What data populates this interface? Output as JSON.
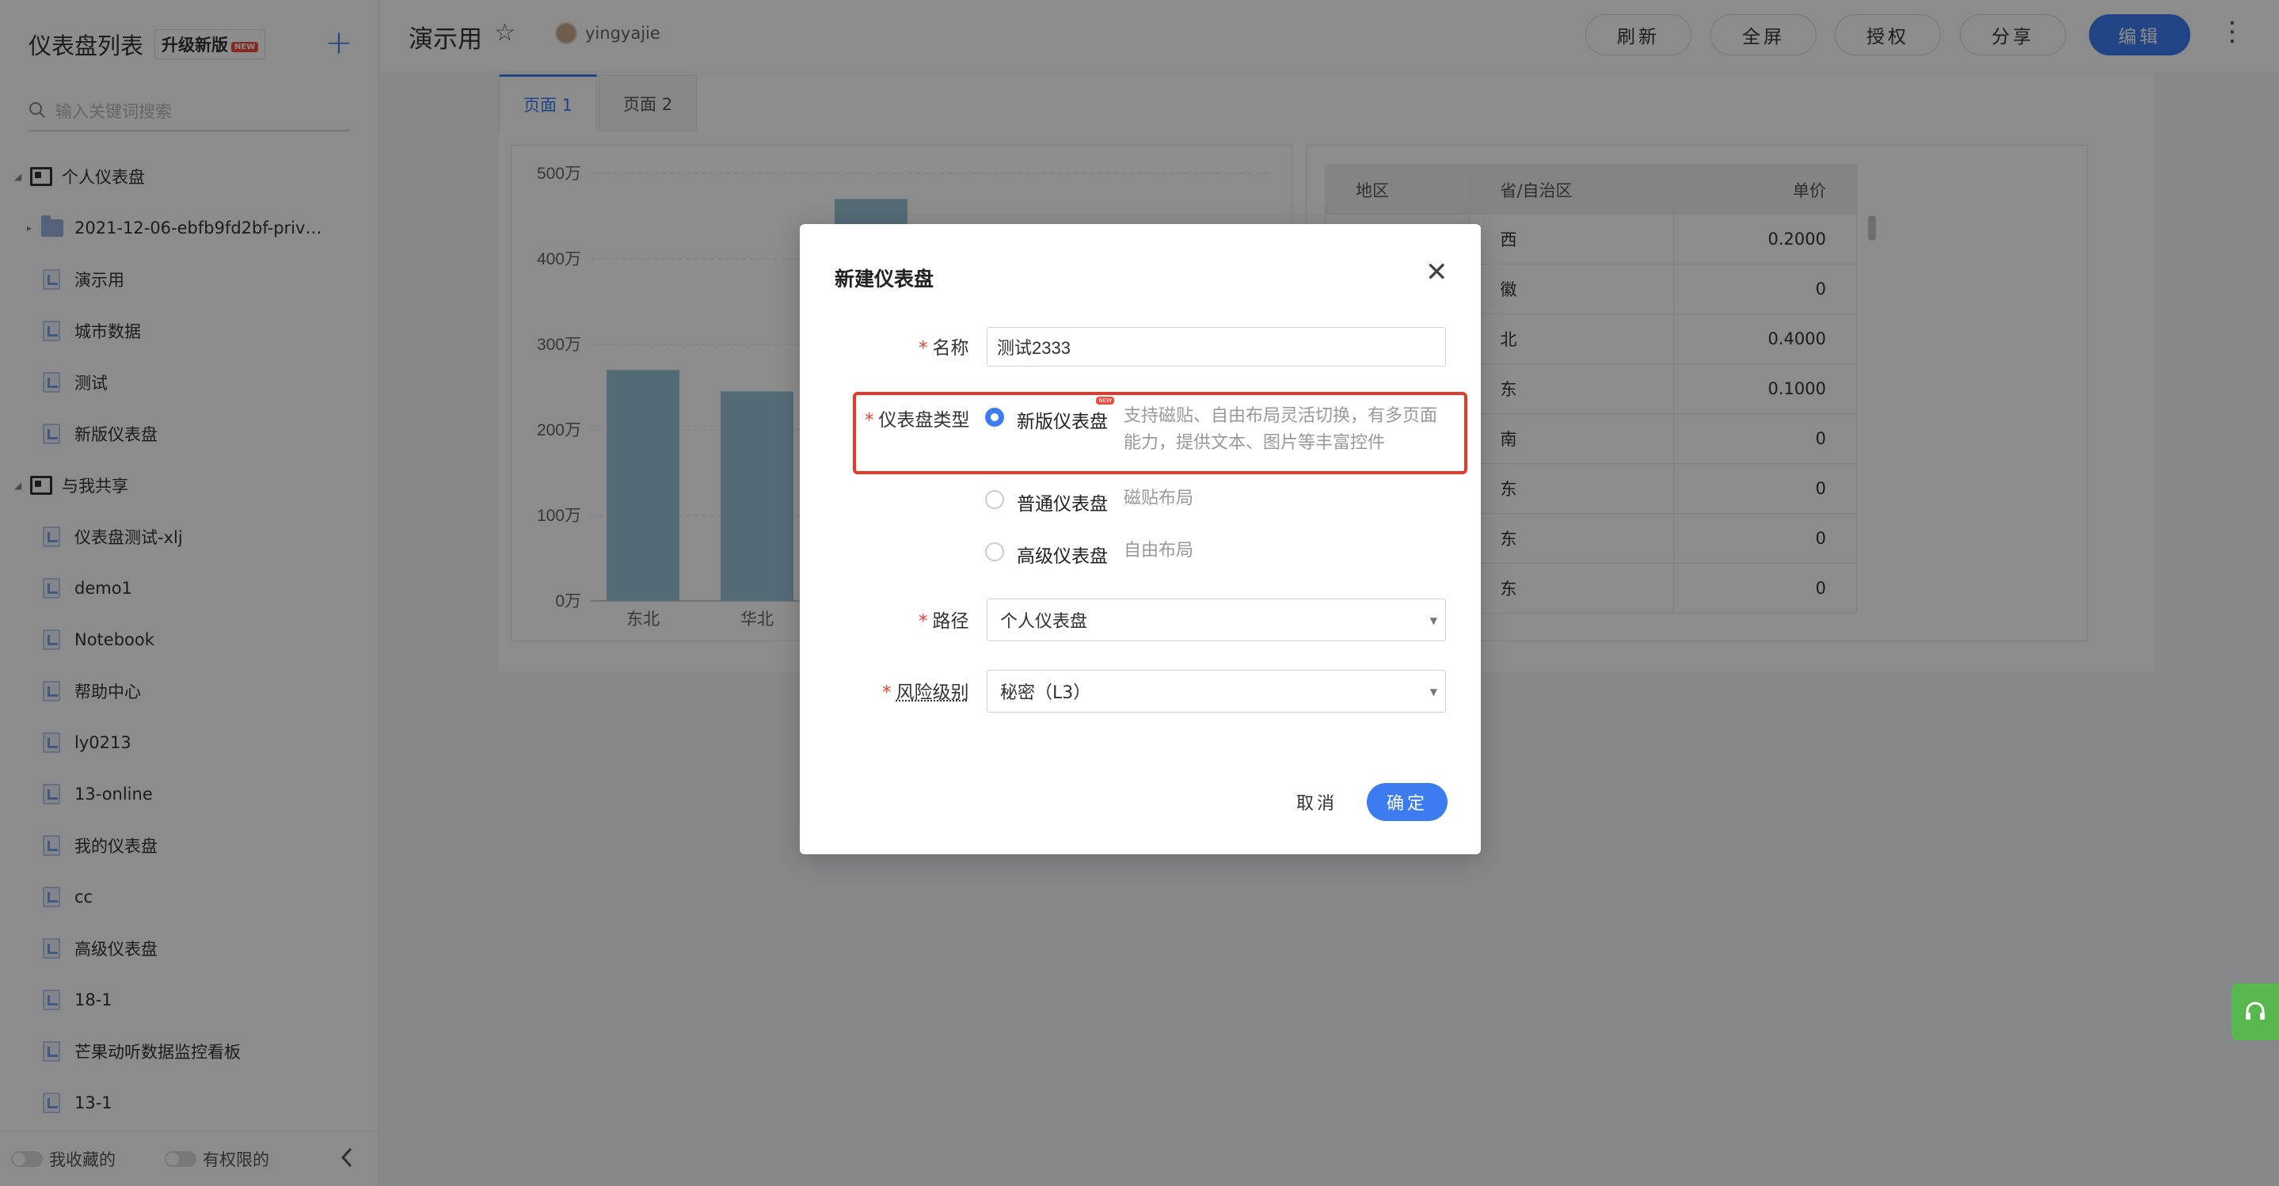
{
  "sidebar": {
    "title": "仪表盘列表",
    "upgrade_label": "升级新版",
    "upgrade_badge": "NEW",
    "add_icon": "+",
    "search_placeholder": "输入关键词搜索",
    "groups": [
      {
        "label": "个人仪表盘",
        "items": [
          {
            "label": "2021-12-06-ebfb9fd2bf-privat...",
            "type": "folder"
          },
          {
            "label": "演示用",
            "type": "doc"
          },
          {
            "label": "城市数据",
            "type": "doc"
          },
          {
            "label": "测试",
            "type": "doc"
          },
          {
            "label": "新版仪表盘",
            "type": "doc"
          }
        ]
      },
      {
        "label": "与我共享",
        "items": [
          {
            "label": "仪表盘测试-xlj",
            "type": "doc"
          },
          {
            "label": "demo1",
            "type": "doc"
          },
          {
            "label": "Notebook",
            "type": "doc"
          },
          {
            "label": "帮助中心",
            "type": "doc"
          },
          {
            "label": "ly0213",
            "type": "doc"
          },
          {
            "label": "13-online",
            "type": "doc"
          },
          {
            "label": "我的仪表盘",
            "type": "doc"
          },
          {
            "label": "cc",
            "type": "doc"
          },
          {
            "label": "高级仪表盘",
            "type": "doc"
          },
          {
            "label": "18-1",
            "type": "doc"
          },
          {
            "label": "芒果动听数据监控看板",
            "type": "doc"
          },
          {
            "label": "13-1",
            "type": "doc"
          }
        ]
      }
    ],
    "footer": {
      "favorites_label": "我收藏的",
      "permitted_label": "有权限的"
    }
  },
  "header": {
    "title": "演示用",
    "owner": "yingyajie",
    "buttons": {
      "refresh": "刷新",
      "fullscreen": "全屏",
      "authorize": "授权",
      "share": "分享",
      "edit": "编辑"
    }
  },
  "tabs": [
    "页面 1",
    "页面 2"
  ],
  "chart_data": {
    "type": "bar",
    "categories": [
      "东北",
      "华北",
      ""
    ],
    "values": [
      2700000,
      2450000,
      4700000
    ],
    "yticks": [
      "0万",
      "100万",
      "200万",
      "300万",
      "400万",
      "500万"
    ],
    "ylim": [
      0,
      5000000
    ],
    "bar_color": "#96c4d6"
  },
  "table": {
    "headers": [
      "地区",
      "省/自治区",
      "单价"
    ],
    "rows": [
      [
        "",
        "西",
        "0.2000"
      ],
      [
        "",
        "徽",
        "0"
      ],
      [
        "",
        "北",
        "0.4000"
      ],
      [
        "",
        "东",
        "0.1000"
      ],
      [
        "",
        "南",
        "0"
      ],
      [
        "",
        "东",
        "0"
      ],
      [
        "",
        "东",
        "0"
      ],
      [
        "",
        "东",
        "0"
      ]
    ]
  },
  "modal": {
    "title": "新建仪表盘",
    "name_label": "名称",
    "name_value": "测试2333",
    "type_label": "仪表盘类型",
    "options": [
      {
        "label": "新版仪表盘",
        "desc": "支持磁贴、自由布局灵活切换，有多页面能力，提供文本、图片等丰富控件",
        "badge": "NEW",
        "checked": true
      },
      {
        "label": "普通仪表盘",
        "desc": "磁贴布局",
        "checked": false
      },
      {
        "label": "高级仪表盘",
        "desc": "自由布局",
        "checked": false
      }
    ],
    "path_label": "路径",
    "path_value": "个人仪表盘",
    "risk_label": "风险级别",
    "risk_value": "秘密（L3）",
    "cancel_label": "取消",
    "ok_label": "确定"
  },
  "colors": {
    "accent": "#3d7cf0",
    "highlight": "#e43a2b",
    "help": "#58b84f"
  }
}
